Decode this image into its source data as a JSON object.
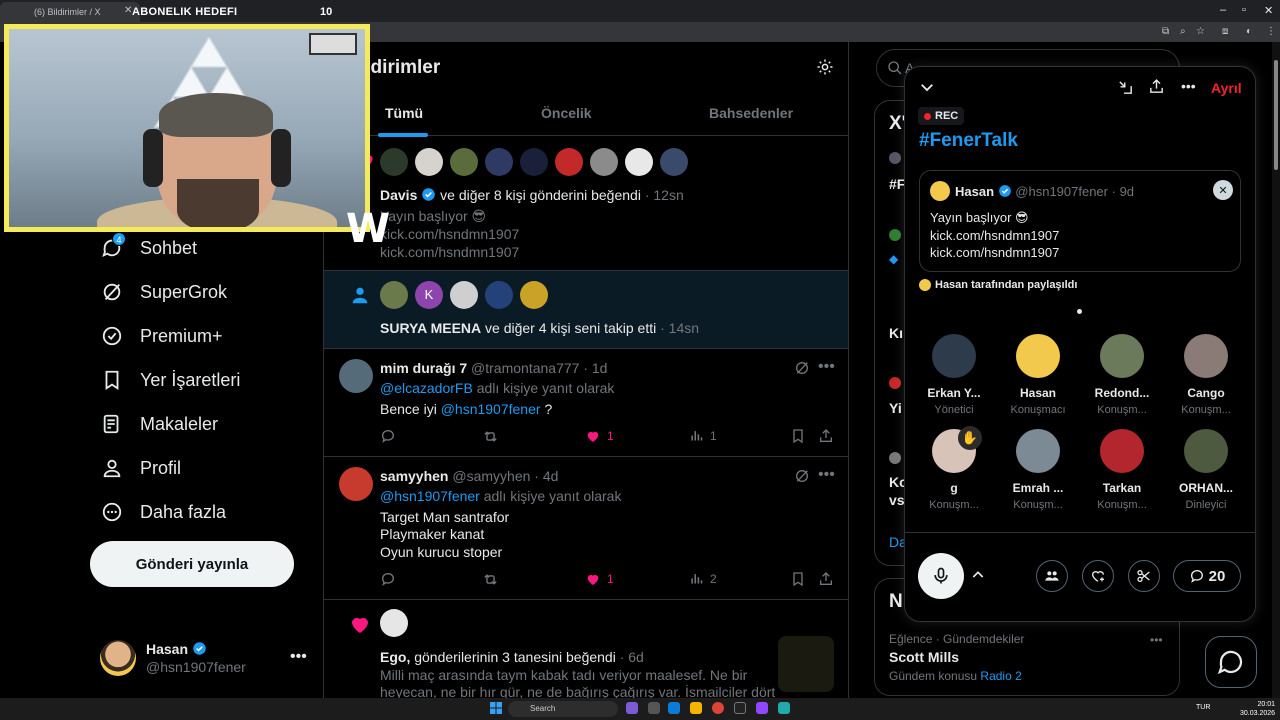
{
  "browser": {
    "tab_title": "(6) Bildirimler / X",
    "goal_label": "ABONELIK HEDEFI",
    "goal_count": "10"
  },
  "nav": {
    "badge": "4",
    "items": [
      {
        "label": "Sohbet",
        "icon": "chat-icon"
      },
      {
        "label": "SuperGrok",
        "icon": "grok-icon"
      },
      {
        "label": "Premium+",
        "icon": "verified-icon"
      },
      {
        "label": "Yer İşaretleri",
        "icon": "bookmark-icon"
      },
      {
        "label": "Makaleler",
        "icon": "article-icon"
      },
      {
        "label": "Profil",
        "icon": "profile-icon"
      },
      {
        "label": "Daha fazla",
        "icon": "more-circle-icon"
      }
    ],
    "post_button": "Gönderi yayınla",
    "me": {
      "name": "Hasan",
      "handle": "@hsn1907fener"
    }
  },
  "notifications": {
    "title": "ildirimler",
    "tabs": [
      "Tümü",
      "Öncelik",
      "Bahsedenler"
    ],
    "like_group": {
      "name": "Davis",
      "text": "ve diğer 8 kişi gönderini beğendi",
      "time": "· 12sn",
      "line1": "Yayın başlıyor 😎",
      "line2": "kick.com/hsndmn1907",
      "line3": "kick.com/hsndmn1907"
    },
    "follow_group": {
      "name": "SURYA MEENA",
      "text": "ve diğer 4 kişi seni takip etti",
      "time": "· 14sn",
      "k_letter": "K"
    },
    "reply1": {
      "name": "mim durağı 7",
      "handle": "@tramontana777",
      "time": "· 1d",
      "reply_to": "@elcazadorFB",
      "reply_suffix": "adlı kişiye yanıt olarak",
      "body_prefix": "Bence iyi",
      "body_mention": "@hsn1907fener",
      "body_suffix": "?",
      "likes": "1",
      "views": "1"
    },
    "reply2": {
      "name": "samyyhen",
      "handle": "@samyyhen",
      "time": "· 4d",
      "reply_to": "@hsn1907fener",
      "reply_suffix": "adlı kişiye yanıt olarak",
      "line1": "Target Man santrafor",
      "line2": "Playmaker kanat",
      "line3": "Oyun kurucu stoper",
      "likes": "1",
      "views": "2"
    },
    "ego": {
      "name": "Ego,",
      "text": "gönderilerinin 3 tanesini beğendi",
      "time": "· 6d",
      "line1": "Milli maç arasında taym kabak tadı veriyor maalesef. Ne bir",
      "line2": "heyecan, ne bir hır gür, ne de bağırış çağırış var. İsmailciler dört"
    }
  },
  "right": {
    "search_placeholder": "A",
    "trend_fragments": [
      "X'",
      "#F",
      "Kı",
      "Yi",
      "Ko",
      "vs",
      "Da",
      "N"
    ],
    "trend": {
      "category": "Eğlence · Gündemdekiler",
      "name": "Scott Mills",
      "sub_prefix": "Gündem konusu",
      "sub_link": "Radio 2"
    }
  },
  "space": {
    "leave": "Ayrıl",
    "rec": "REC",
    "title": "#FenerTalk",
    "pinned": {
      "name": "Hasan",
      "handle": "@hsn1907fener",
      "time": "· 9d",
      "line1": "Yayın başlıyor 😎",
      "line2": "kick.com/hsndmn1907",
      "line3": "kick.com/hsndmn1907"
    },
    "shared_by": "Hasan tarafından paylaşıldı",
    "people": [
      {
        "name": "Erkan Y...",
        "role": "Yönetici",
        "color": "#2e3b4a"
      },
      {
        "name": "Hasan",
        "role": "Konuşmacı",
        "color": "#f2c94c"
      },
      {
        "name": "Redond...",
        "role": "Konuşm...",
        "color": "#6b7a5a"
      },
      {
        "name": "Cango",
        "role": "Konuşm...",
        "color": "#8a7b76"
      },
      {
        "name": "g",
        "role": "Konuşm...",
        "color": "#d8c3b8"
      },
      {
        "name": "Emrah ...",
        "role": "Konuşm...",
        "color": "#7c8a96"
      },
      {
        "name": "Tarkan",
        "role": "Konuşm...",
        "color": "#b3262e"
      },
      {
        "name": "ORHAN...",
        "role": "Dinleyici",
        "color": "#4d5a3f"
      }
    ],
    "count": "20"
  },
  "taskbar": {
    "search": "Search",
    "lang": "TUR",
    "time": "20:01",
    "date": "30.03.2026"
  },
  "colors": {
    "accent": "#1d9bf0",
    "like": "#f91880",
    "leave": "#f4212e",
    "webcam_border": "#f5ea5a"
  }
}
